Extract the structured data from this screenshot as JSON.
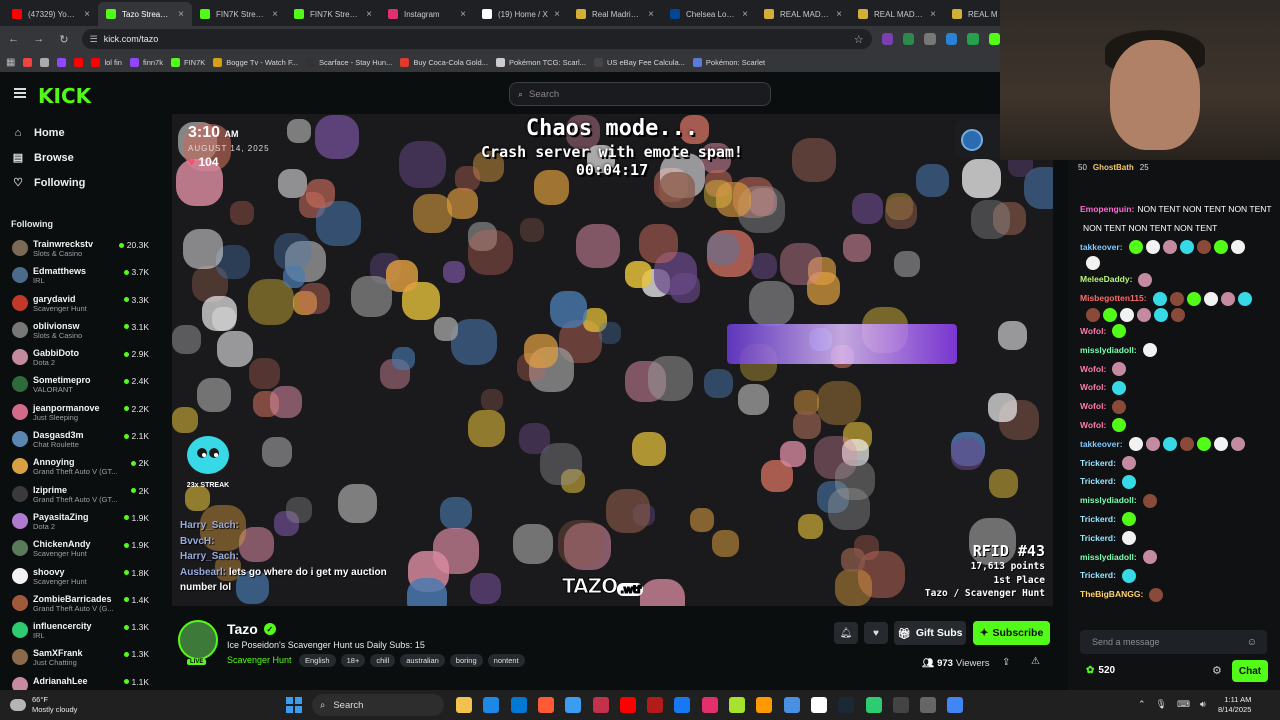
{
  "browser": {
    "tabs": [
      {
        "label": "(47329) YouTube",
        "color": "#ff0000",
        "active": false
      },
      {
        "label": "Tazo Stream - Kick",
        "color": "#53fc18",
        "active": true
      },
      {
        "label": "FIN7K Stream",
        "color": "#53fc18",
        "active": false
      },
      {
        "label": "FIN7K Stream",
        "color": "#53fc18",
        "active": false
      },
      {
        "label": "Instagram",
        "color": "#e1306c",
        "active": false
      },
      {
        "label": "(19) Home / X",
        "color": "#ffffff",
        "active": false
      },
      {
        "label": "Real Madrid CF",
        "color": "#d4af37",
        "active": false
      },
      {
        "label": "Chelsea London",
        "color": "#034694",
        "active": false
      },
      {
        "label": "REAL MADRID",
        "color": "#d4af37",
        "active": false
      },
      {
        "label": "REAL MADRID",
        "color": "#d4af37",
        "active": false
      },
      {
        "label": "REAL M",
        "color": "#d4af37",
        "active": false
      }
    ],
    "url": "kick.com/tazo",
    "bookmarks": [
      {
        "label": "lol fin",
        "color": "#ff0000"
      },
      {
        "label": "finn7k",
        "color": "#9146ff"
      },
      {
        "label": "FIN7K",
        "color": "#53fc18"
      },
      {
        "label": "Bogge Tv - Watch F...",
        "color": "#d4a017"
      },
      {
        "label": "Scarface - Stay Hun...",
        "color": "#333333"
      },
      {
        "label": "Buy Coca-Cola Gold...",
        "color": "#e23b2d"
      },
      {
        "label": "Pokémon TCG: Scarl...",
        "color": "#cccccc"
      },
      {
        "label": "US eBay Fee Calcula...",
        "color": "#444444"
      },
      {
        "label": "Pokémon: Scarlet",
        "color": "#5a7bd8"
      }
    ]
  },
  "kick": {
    "logo": "KICK",
    "search_placeholder": "Search",
    "nav": [
      {
        "label": "Home",
        "icon": "home-icon",
        "glyph": "⌂"
      },
      {
        "label": "Browse",
        "icon": "browse-icon",
        "glyph": "▤"
      },
      {
        "label": "Following",
        "icon": "heart-icon",
        "glyph": "♡"
      }
    ],
    "following_title": "Following",
    "following": [
      {
        "name": "Trainwreckstv",
        "category": "Slots & Casino",
        "viewers": "20.3K",
        "color": "#7a6a55"
      },
      {
        "name": "Edmatthews",
        "category": "IRL",
        "viewers": "3.7K",
        "color": "#4b6b8a"
      },
      {
        "name": "garydavid",
        "category": "Scavenger Hunt",
        "viewers": "3.3K",
        "color": "#c0392b"
      },
      {
        "name": "oblivionsw",
        "category": "Slots & Casino",
        "viewers": "3.1K",
        "color": "#777777"
      },
      {
        "name": "GabbiDoto",
        "category": "Dota 2",
        "viewers": "2.9K",
        "color": "#c48b9f"
      },
      {
        "name": "Sometimepro",
        "category": "VALORANT",
        "viewers": "2.4K",
        "color": "#2f6b3a"
      },
      {
        "name": "jeanpormanove",
        "category": "Just Sleeping",
        "viewers": "2.2K",
        "color": "#d46a8a"
      },
      {
        "name": "Dasgasd3m",
        "category": "Chat Roulette",
        "viewers": "2.1K",
        "color": "#5a86b0"
      },
      {
        "name": "Annoying",
        "category": "Grand Theft Auto V (GT...",
        "viewers": "2K",
        "color": "#d8a040"
      },
      {
        "name": "Iziprime",
        "category": "Grand Theft Auto V (GT...",
        "viewers": "2K",
        "color": "#3a3a3a"
      },
      {
        "name": "PayasitaZing",
        "category": "Dota 2",
        "viewers": "1.9K",
        "color": "#b07ad0"
      },
      {
        "name": "ChickenAndy",
        "category": "Scavenger Hunt",
        "viewers": "1.9K",
        "color": "#5a7a5a"
      },
      {
        "name": "shoovy",
        "category": "Scavenger Hunt",
        "viewers": "1.8K",
        "color": "#f2f2f2"
      },
      {
        "name": "ZombieBarricades",
        "category": "Grand Theft Auto V (G...",
        "viewers": "1.4K",
        "color": "#a05a3a"
      },
      {
        "name": "influencercity",
        "category": "IRL",
        "viewers": "1.3K",
        "color": "#2ecc71"
      },
      {
        "name": "SamXFrank",
        "category": "Just Chatting",
        "viewers": "1.3K",
        "color": "#8a6a4a"
      },
      {
        "name": "AdrianahLee",
        "category": "",
        "viewers": "1.1K",
        "color": "#c98aa0"
      }
    ]
  },
  "video": {
    "time": "3:10",
    "ampm": "AM",
    "date": "AUGUST 14, 2025",
    "heart_count": "104",
    "chaos_line1": "Chaos mode...",
    "chaos_line2": "Crash server with emote spam!",
    "chaos_timer": "00:04:17",
    "streak_label": "23x STREAK",
    "overlay_chat": [
      {
        "user": "Harry_Sach:",
        "text": ""
      },
      {
        "user": "BvvcH:",
        "text": ""
      },
      {
        "user": "Harry_Sach:",
        "text": ""
      },
      {
        "user": "Ausbearl:",
        "text": "lets go where do i get my auction"
      },
      {
        "user": "",
        "text": "number lol"
      }
    ],
    "rfid_title": "RFID #43",
    "rfid_points": "17,613 points",
    "rfid_place": "1st Place",
    "rfid_footer": "Tazo / Scavenger Hunt",
    "watermark": "TAZO",
    "watermark_suffix": ".wtf"
  },
  "stream": {
    "name": "Tazo",
    "title": "Ice Poseidon's Scavenger Hunt us Daily Subs: 15",
    "category": "Scavenger Hunt",
    "tags": [
      "English",
      "18+",
      "chill",
      "australian",
      "boring",
      "nontent"
    ],
    "gift_label": "Gift Subs",
    "subscribe_label": "Subscribe",
    "viewers": "973",
    "viewers_label": "Viewers"
  },
  "chat": {
    "top_count_1": "50",
    "top_user": "GhostBath",
    "top_count_2": "25",
    "messages": [
      {
        "user": "Emopenguin:",
        "text": "NON TENT NON TENT NON TENT",
        "color": "#ff6ad5"
      },
      {
        "user": "",
        "text": "NON TENT NON TENT NON TENT",
        "color": "#ffffff"
      },
      {
        "user": "takkeover:",
        "text": "",
        "color": "#7ec8ff"
      },
      {
        "user": "",
        "text": "",
        "color": "#ffffff"
      },
      {
        "user": "MeleeDaddy:",
        "text": "",
        "color": "#b8f57a"
      },
      {
        "user": "Misbegotten115:",
        "text": "",
        "color": "#ff6a6a"
      },
      {
        "user": "",
        "text": "",
        "color": "#ffffff"
      },
      {
        "user": "Wofol:",
        "text": "",
        "color": "#ff7aa8"
      },
      {
        "user": "misslydiadoll:",
        "text": "",
        "color": "#7cffb0"
      },
      {
        "user": "Wofol:",
        "text": "",
        "color": "#ff7aa8"
      },
      {
        "user": "Wofol:",
        "text": "",
        "color": "#ff7aa8"
      },
      {
        "user": "Wofol:",
        "text": "",
        "color": "#ff7aa8"
      },
      {
        "user": "Wofol:",
        "text": "",
        "color": "#ff7aa8"
      },
      {
        "user": "takkeover:",
        "text": "",
        "color": "#7ec8ff"
      },
      {
        "user": "Trickerd:",
        "text": "",
        "color": "#9ae6ff"
      },
      {
        "user": "Trickerd:",
        "text": "",
        "color": "#9ae6ff"
      },
      {
        "user": "misslydiadoll:",
        "text": "",
        "color": "#7cffb0"
      },
      {
        "user": "Trickerd:",
        "text": "",
        "color": "#9ae6ff"
      },
      {
        "user": "Trickerd:",
        "text": "",
        "color": "#9ae6ff"
      },
      {
        "user": "misslydiadoll:",
        "text": "",
        "color": "#7cffb0"
      },
      {
        "user": "Trickerd:",
        "text": "",
        "color": "#9ae6ff"
      },
      {
        "user": "TheBigBANGG:",
        "text": "",
        "color": "#ffd36a"
      }
    ],
    "input_placeholder": "Send a message",
    "points": "520",
    "chat_button": "Chat"
  },
  "taskbar": {
    "temp": "66°F",
    "weather": "Mostly cloudy",
    "search_label": "Search",
    "time": "1:11 AM",
    "date": "8/14/2025"
  },
  "colors": {
    "kick_green": "#53fc18"
  }
}
